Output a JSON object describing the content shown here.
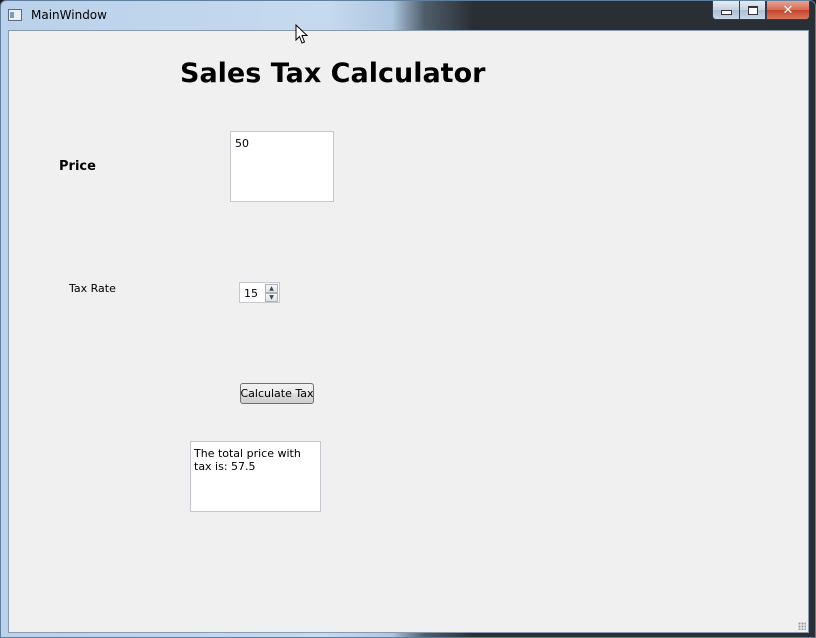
{
  "window": {
    "title": "MainWindow",
    "minimize_glyph": "",
    "maximize_glyph": "",
    "close_glyph": "✕"
  },
  "form": {
    "heading": "Sales Tax Calculator",
    "price_label": "Price",
    "price_value": "50",
    "tax_rate_label": "Tax Rate",
    "tax_rate_value": "15",
    "spin_up_glyph": "▲",
    "spin_down_glyph": "▼",
    "calculate_label": "Calculate Tax",
    "result_text": "The total price with tax is: 57.5"
  },
  "icons": {
    "app": "window-icon",
    "cursor": "mouse-pointer-icon",
    "grip": "resize-grip-icon"
  }
}
